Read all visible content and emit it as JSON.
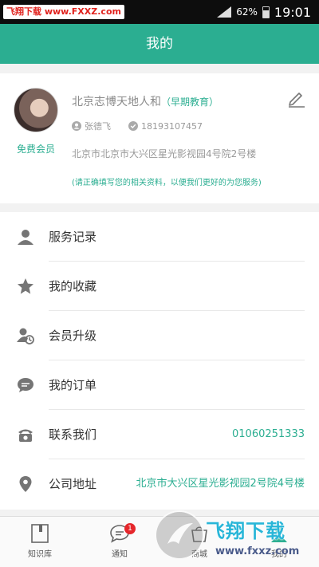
{
  "status_bar": {
    "watermark": "飞翔下载 www.FXXZ.com",
    "battery": "62%",
    "time": "19:01"
  },
  "header": {
    "title": "我的"
  },
  "profile": {
    "member_level": "免费会员",
    "company_name": "北京志博天地人和",
    "company_category": "（早期教育）",
    "contact_name": "张德飞",
    "phone": "18193107457",
    "address": "北京市北京市大兴区星光影视园4号院2号楼",
    "notice": "(请正确填写您的相关资料，以便我们更好的为您服务)"
  },
  "menu": {
    "items": [
      {
        "label": "服务记录",
        "icon": "person-icon"
      },
      {
        "label": "我的收藏",
        "icon": "star-icon"
      },
      {
        "label": "会员升级",
        "icon": "member-upgrade-icon"
      },
      {
        "label": "我的订单",
        "icon": "chat-bubble-icon"
      },
      {
        "label": "联系我们",
        "icon": "telephone-icon",
        "value": "01060251333"
      },
      {
        "label": "公司地址",
        "icon": "location-pin-icon",
        "value": "北京市大兴区星光影视园2号院4号楼"
      }
    ]
  },
  "tabbar": {
    "tabs": [
      {
        "label": "知识库",
        "icon": "book-icon"
      },
      {
        "label": "通知",
        "icon": "message-icon",
        "badge": "1"
      },
      {
        "label": "商城",
        "icon": "shop-icon"
      },
      {
        "label": "我的",
        "icon": "profile-icon"
      }
    ]
  },
  "watermark_bottom": {
    "title": "飞翔下载",
    "url": "www.fxxz.com"
  },
  "colors": {
    "accent": "#2bae91",
    "status_bar": "#0d0d0d",
    "badge": "#e5262b",
    "background": "#f2f2f2"
  }
}
